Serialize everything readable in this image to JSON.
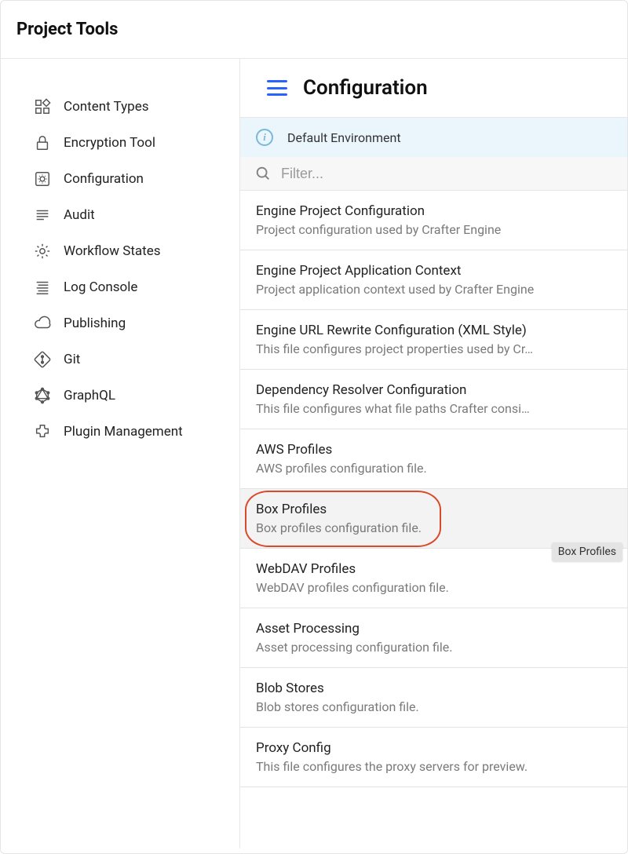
{
  "header": {
    "title": "Project Tools"
  },
  "sidebar": {
    "items": [
      {
        "label": "Content Types",
        "icon": "grid-icon"
      },
      {
        "label": "Encryption Tool",
        "icon": "lock-icon"
      },
      {
        "label": "Configuration",
        "icon": "config-icon"
      },
      {
        "label": "Audit",
        "icon": "lines-icon"
      },
      {
        "label": "Workflow States",
        "icon": "gear-icon"
      },
      {
        "label": "Log Console",
        "icon": "log-icon"
      },
      {
        "label": "Publishing",
        "icon": "cloud-icon"
      },
      {
        "label": "Git",
        "icon": "git-icon"
      },
      {
        "label": "GraphQL",
        "icon": "graphql-icon"
      },
      {
        "label": "Plugin Management",
        "icon": "plugin-icon"
      }
    ]
  },
  "main": {
    "title": "Configuration",
    "environment_label": "Default Environment",
    "filter_placeholder": "Filter...",
    "highlighted_index": 5,
    "tooltip_text": "Box Profiles",
    "items": [
      {
        "title": "Engine Project Configuration",
        "desc": "Project configuration used by Crafter Engine"
      },
      {
        "title": "Engine Project Application Context",
        "desc": "Project application context used by Crafter Engine"
      },
      {
        "title": "Engine URL Rewrite Configuration (XML Style)",
        "desc": "This file configures project properties used by Cr…"
      },
      {
        "title": "Dependency Resolver Configuration",
        "desc": "This file configures what file paths Crafter consi…"
      },
      {
        "title": "AWS Profiles",
        "desc": "AWS profiles configuration file."
      },
      {
        "title": "Box Profiles",
        "desc": "Box profiles configuration file."
      },
      {
        "title": "WebDAV Profiles",
        "desc": "WebDAV profiles configuration file."
      },
      {
        "title": "Asset Processing",
        "desc": "Asset processing configuration file."
      },
      {
        "title": "Blob Stores",
        "desc": "Blob stores configuration file."
      },
      {
        "title": "Proxy Config",
        "desc": "This file configures the proxy servers for preview."
      }
    ]
  }
}
